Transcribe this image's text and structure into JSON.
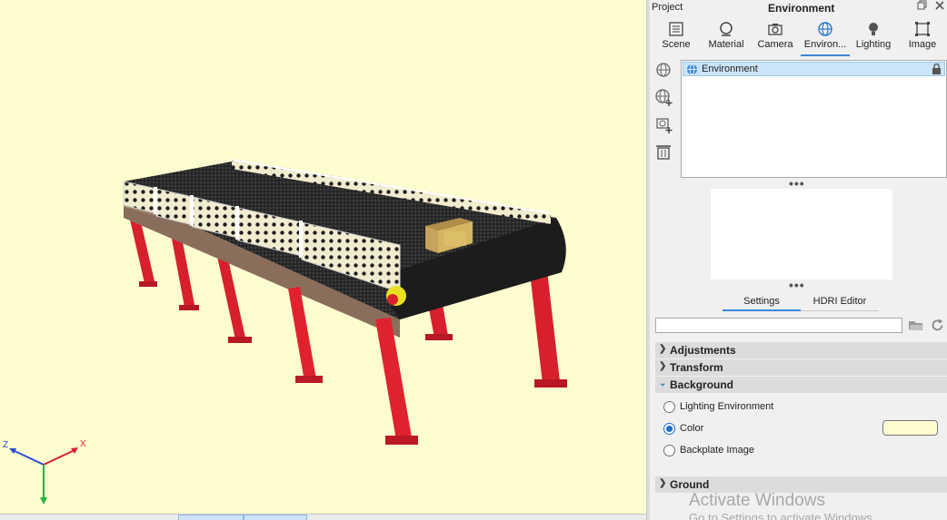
{
  "panel": {
    "project_label": "Project",
    "title": "Environment",
    "restore_icon": "restore-window-icon",
    "close_icon": "close-icon"
  },
  "tabs": [
    {
      "label": "Scene",
      "icon": "scene-list-icon"
    },
    {
      "label": "Material",
      "icon": "material-sphere-icon"
    },
    {
      "label": "Camera",
      "icon": "camera-icon"
    },
    {
      "label": "Environ...",
      "icon": "globe-icon",
      "active": true
    },
    {
      "label": "Lighting",
      "icon": "lightbulb-icon"
    },
    {
      "label": "Image",
      "icon": "image-frame-icon"
    }
  ],
  "environment_list": {
    "items": [
      {
        "label": "Environment",
        "icon": "globe-icon",
        "locked": true
      }
    ]
  },
  "subtabs": {
    "settings": "Settings",
    "hdri_editor": "HDRI Editor"
  },
  "path_input": {
    "value": ""
  },
  "sections": {
    "adjustments": "Adjustments",
    "transform": "Transform",
    "background": "Background",
    "ground": "Ground"
  },
  "background": {
    "options": [
      {
        "label": "Lighting Environment",
        "checked": false
      },
      {
        "label": "Color",
        "checked": true
      },
      {
        "label": "Backplate Image",
        "checked": false
      }
    ],
    "color": "#fdfdcf"
  },
  "axes": {
    "z": "Z",
    "x": "X"
  },
  "watermark": {
    "line1": "Activate Windows",
    "line2": "Go to Settings to activate Windows."
  },
  "colors": {
    "viewport_bg": "#fdfdcf",
    "accent": "#3b89d6",
    "leg_red": "#e0222e"
  }
}
